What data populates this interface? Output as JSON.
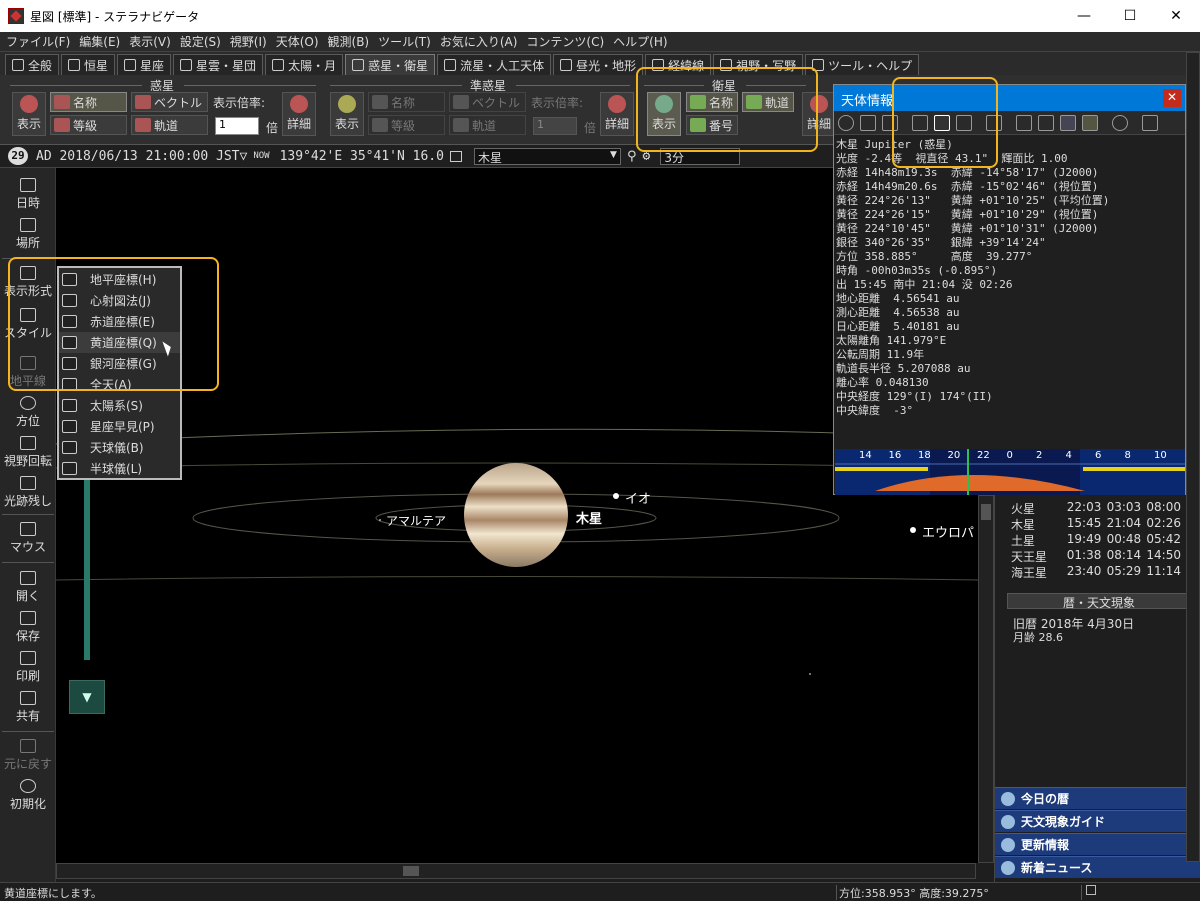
{
  "window": {
    "title": "星図 [標準] - ステラナビゲータ",
    "minimize": "—",
    "maximize": "☐",
    "close": "✕"
  },
  "menu": [
    "ファイル(F)",
    "編集(E)",
    "表示(V)",
    "設定(S)",
    "視野(I)",
    "天体(O)",
    "観測(B)",
    "ツール(T)",
    "お気に入り(A)",
    "コンテンツ(C)",
    "ヘルプ(H)"
  ],
  "tabs": [
    "全般",
    "恒星",
    "星座",
    "星雲・星団",
    "太陽・月",
    "惑星・衛星",
    "流星・人工天体",
    "昼光・地形",
    "経緯線",
    "視野・写野",
    "ツール・ヘルプ"
  ],
  "ribbon": {
    "planet": {
      "title": "惑星",
      "show": "表示",
      "name": "名称",
      "vector": "ベクトル",
      "magnitude": "等級",
      "orbit": "軌道",
      "scale_label": "表示倍率:",
      "scale_value": "1",
      "times": "倍",
      "detail": "詳細"
    },
    "minor": {
      "title": "準惑星",
      "show": "表示",
      "name": "名称",
      "vector": "ベクトル",
      "magnitude": "等級",
      "orbit": "軌道",
      "scale_label": "表示倍率:",
      "scale_value": "1",
      "times": "倍",
      "detail": "詳細"
    },
    "satellite": {
      "title": "衛星",
      "show": "表示",
      "name": "名称",
      "orbit": "軌道",
      "number": "番号",
      "detail": "詳細"
    }
  },
  "infobar": {
    "day": "29",
    "datetime": "AD 2018/06/13 21:00:00 JST▽",
    "now": "NOW",
    "position": "139°42'E 35°41'N 16.0",
    "target": "木星",
    "step": "3分"
  },
  "leftbar": [
    {
      "label": "日時",
      "disabled": false
    },
    {
      "label": "場所",
      "disabled": false
    },
    {
      "label": "表示形式",
      "disabled": false
    },
    {
      "label": "スタイル",
      "disabled": false
    },
    {
      "label": "地平線",
      "disabled": true
    },
    {
      "label": "方位",
      "disabled": false
    },
    {
      "label": "視野回転",
      "disabled": false
    },
    {
      "label": "光跡残し",
      "disabled": false
    },
    {
      "label": "マウス",
      "disabled": false
    },
    {
      "label": "開く",
      "disabled": false
    },
    {
      "label": "保存",
      "disabled": false
    },
    {
      "label": "印刷",
      "disabled": false
    },
    {
      "label": "共有",
      "disabled": false
    },
    {
      "label": "元に戻す",
      "disabled": true
    },
    {
      "label": "初期化",
      "disabled": false
    }
  ],
  "dropdown": [
    "地平座標(H)",
    "心射図法(J)",
    "赤道座標(E)",
    "黄道座標(Q)",
    "銀河座標(G)",
    "全天(A)",
    "太陽系(S)",
    "星座早見(P)",
    "天球儀(B)",
    "半球儀(L)"
  ],
  "sky_labels": {
    "jupiter": "木星",
    "io": "イオ",
    "amalthea": "アマルテア",
    "europa": "エウロパ"
  },
  "infopanel": {
    "title": "天体情報",
    "lines": [
      "木星 Jupiter (惑星)",
      "光度 -2.4等  視直径 43.1\"  輝面比 1.00",
      "赤経 14h48m19.3s  赤緯 -14°58'17\" (J2000)",
      "赤経 14h49m20.6s  赤緯 -15°02'46\" (視位置)",
      "黄径 224°26'13\"   黄緯 +01°10'25\" (平均位置)",
      "黄径 224°26'15\"   黄緯 +01°10'29\" (視位置)",
      "黄径 224°10'45\"   黄緯 +01°10'31\" (J2000)",
      "銀径 340°26'35\"   銀緯 +39°14'24\"",
      "方位 358.885°     高度  39.277°",
      "時角 -00h03m35s (-0.895°)",
      "出 15:45 南中 21:04 没 02:26",
      "地心距離  4.56541 au",
      "測心距離  4.56538 au",
      "日心距離  5.40181 au",
      "太陽離角 141.979°E",
      "公転周期 11.9年",
      "軌道長半径 5.207088 au",
      "離心率 0.048130",
      "中央経度 129°(I) 174°(II)",
      "中央緯度  -3°"
    ],
    "timeline_ticks": [
      "14",
      "16",
      "18",
      "20",
      "22",
      "0",
      "2",
      "4",
      "6",
      "8",
      "10"
    ]
  },
  "rise_table": [
    [
      "火星",
      "22:03",
      "03:03",
      "08:00"
    ],
    [
      "木星",
      "15:45",
      "21:04",
      "02:26"
    ],
    [
      "土星",
      "19:49",
      "00:48",
      "05:42"
    ],
    [
      "天王星",
      "01:38",
      "08:14",
      "14:50"
    ],
    [
      "海王星",
      "23:40",
      "05:29",
      "11:14"
    ]
  ],
  "calendar": {
    "header": "暦・天文現象",
    "old_calendar": "旧暦  2018年 4月30日",
    "moon_age": "月齢 28.6"
  },
  "links": [
    "今日の暦",
    "天文現象ガイド",
    "更新情報",
    "新着ニュース"
  ],
  "status": {
    "message": "黄道座標にします。",
    "coords": "方位:358.953° 高度:39.275°"
  },
  "colors": {
    "accent": "#0078d7",
    "highlight": "#f2b51d",
    "jupiter_band": "#c9a57a"
  }
}
